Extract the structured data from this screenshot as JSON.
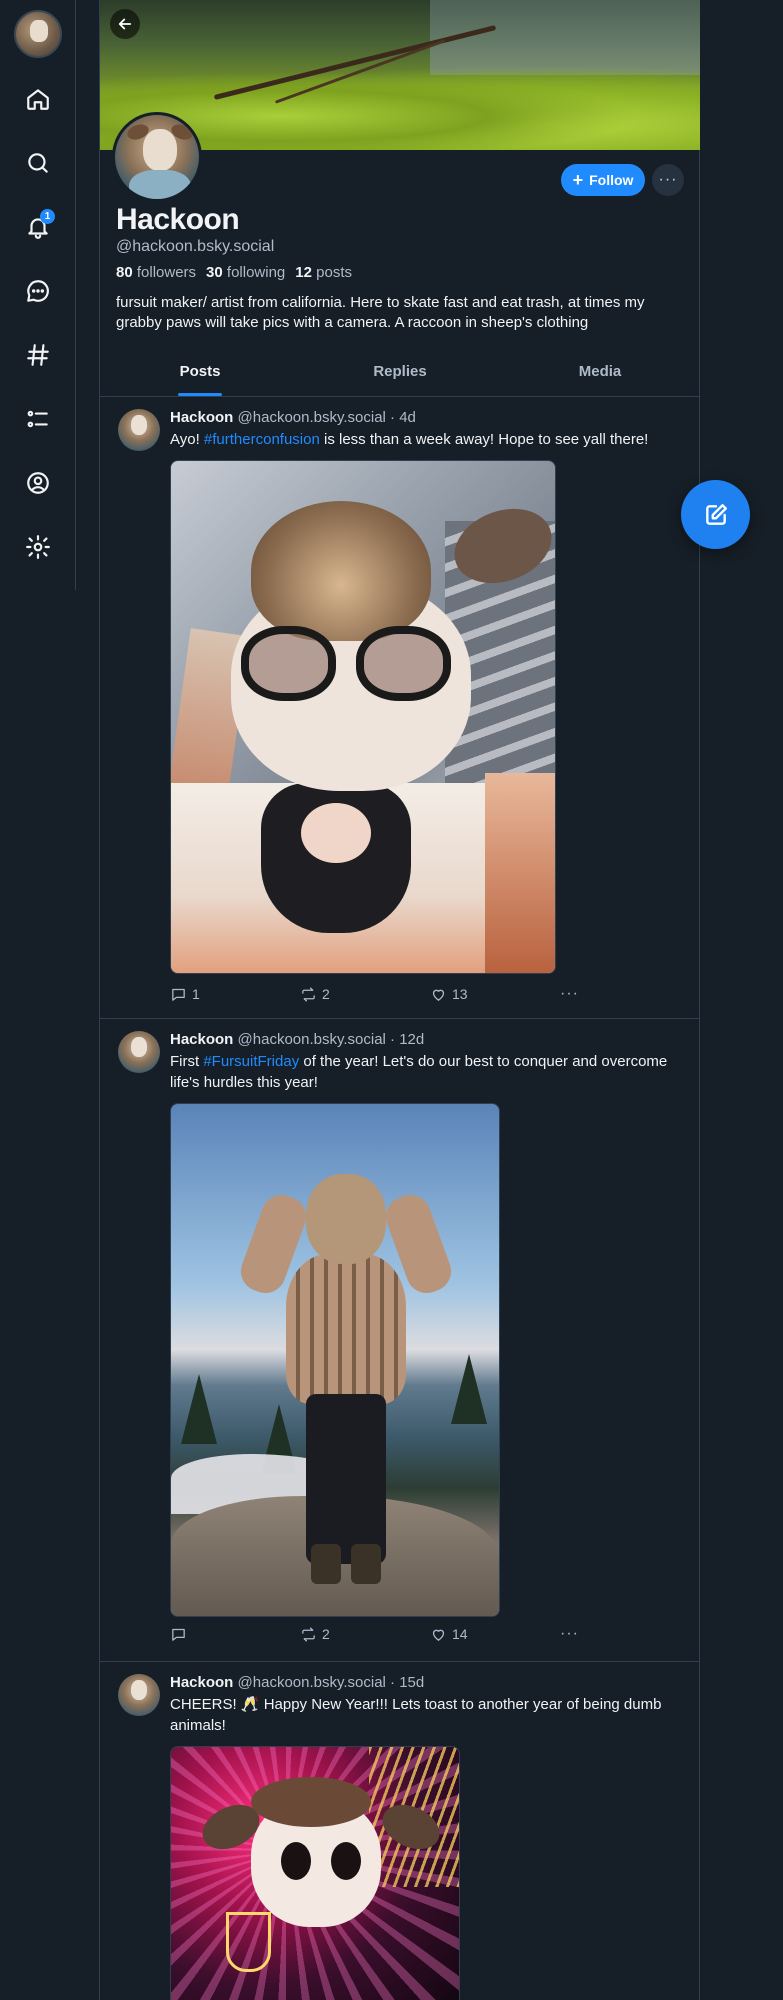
{
  "sidebar": {
    "badge": "1",
    "items": [
      {
        "icon": "home-icon"
      },
      {
        "icon": "search-icon"
      },
      {
        "icon": "bell-icon"
      },
      {
        "icon": "chat-icon"
      },
      {
        "icon": "hashtag-icon"
      },
      {
        "icon": "list-icon"
      },
      {
        "icon": "profile-icon"
      },
      {
        "icon": "gear-icon"
      }
    ]
  },
  "profile": {
    "display_name": "Hackoon",
    "handle": "@hackoon.bsky.social",
    "followers_count": "80",
    "followers_label": "followers",
    "following_count": "30",
    "following_label": "following",
    "posts_count": "12",
    "posts_label": "posts",
    "bio": "fursuit maker/ artist from california. Here to skate fast and eat trash, at times my grabby paws will take pics with a camera. A raccoon in sheep's clothing",
    "follow_label": "Follow",
    "more_label": "···"
  },
  "tabs": [
    {
      "label": "Posts",
      "active": true
    },
    {
      "label": "Replies",
      "active": false
    },
    {
      "label": "Media",
      "active": false
    }
  ],
  "posts": [
    {
      "author": "Hackoon",
      "meta": "@hackoon.bsky.social · 4d",
      "text_before": "Ayo! ",
      "tag": "#furtherconfusion",
      "text_after": " is less than a week away! Hope to see yall there!",
      "replies": "1",
      "reposts": "2",
      "likes": "13"
    },
    {
      "author": "Hackoon",
      "meta": "@hackoon.bsky.social · 12d",
      "text_before": "First ",
      "tag": "#FursuitFriday",
      "text_after": " of the year! Let's do our best to conquer and overcome life's hurdles this year!",
      "replies": "",
      "reposts": "2",
      "likes": "14"
    },
    {
      "author": "Hackoon",
      "meta": "@hackoon.bsky.social · 15d",
      "text_before": "CHEERS! 🥂 Happy New Year!!! Lets toast to another year of being dumb animals!",
      "tag": "",
      "text_after": ""
    }
  ],
  "colors": {
    "background": "#161e27",
    "accent": "#208bfe",
    "muted_text": "#aebbc9",
    "border": "#2e4052"
  }
}
